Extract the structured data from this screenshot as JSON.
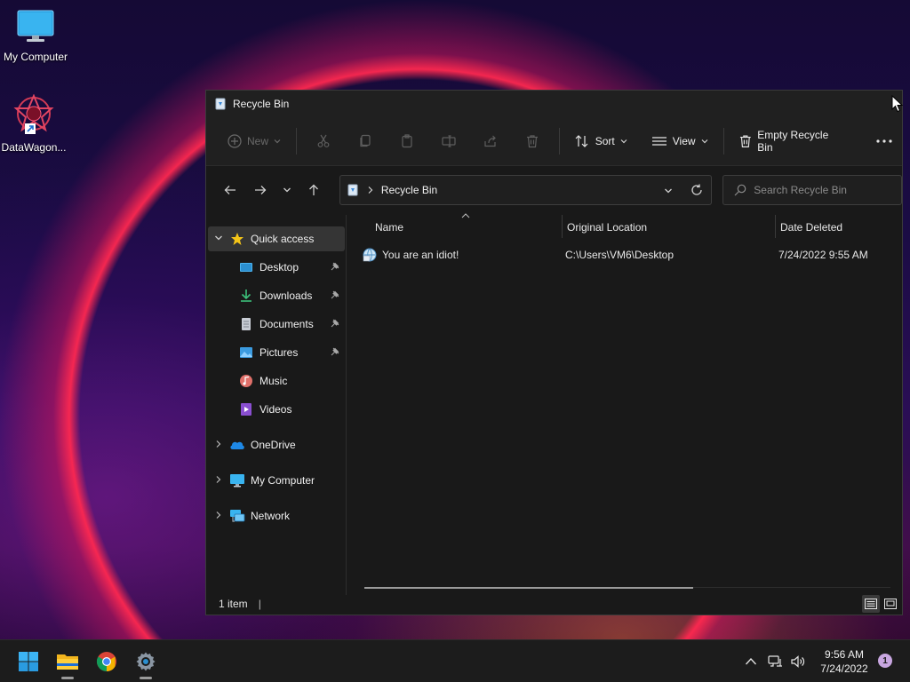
{
  "desktop": {
    "icons": [
      {
        "label": "My Computer",
        "icon": "monitor-icon"
      },
      {
        "label": "DataWagon...",
        "icon": "datawagon-shortcut-icon"
      }
    ]
  },
  "window": {
    "title": "Recycle Bin",
    "toolbar": {
      "new_label": "New",
      "sort_label": "Sort",
      "view_label": "View",
      "empty_label": "Empty Recycle Bin",
      "icons": [
        "cut-icon",
        "copy-icon",
        "paste-icon",
        "rename-icon",
        "share-icon",
        "delete-icon"
      ]
    },
    "address": {
      "crumb": "Recycle Bin",
      "search_placeholder": "Search Recycle Bin"
    },
    "sidebar": {
      "quick_access": "Quick access",
      "items": [
        {
          "label": "Desktop",
          "icon": "desktop-folder-icon",
          "pinned": true
        },
        {
          "label": "Downloads",
          "icon": "downloads-folder-icon",
          "pinned": true
        },
        {
          "label": "Documents",
          "icon": "documents-folder-icon",
          "pinned": true
        },
        {
          "label": "Pictures",
          "icon": "pictures-folder-icon",
          "pinned": true
        },
        {
          "label": "Music",
          "icon": "music-folder-icon",
          "pinned": false
        },
        {
          "label": "Videos",
          "icon": "videos-folder-icon",
          "pinned": false
        }
      ],
      "roots": [
        {
          "label": "OneDrive",
          "icon": "onedrive-icon"
        },
        {
          "label": "My Computer",
          "icon": "monitor-icon"
        },
        {
          "label": "Network",
          "icon": "network-icon"
        }
      ]
    },
    "columns": {
      "name": "Name",
      "original_location": "Original Location",
      "date_deleted": "Date Deleted"
    },
    "files": [
      {
        "name": "You are an idiot!",
        "original_location": "C:\\Users\\VM6\\Desktop",
        "date_deleted": "7/24/2022 9:55 AM"
      }
    ],
    "status": {
      "count": "1 item",
      "separator": "|"
    }
  },
  "taskbar": {
    "apps": [
      "start-icon",
      "file-explorer-icon",
      "chrome-icon",
      "settings-icon"
    ],
    "clock_time": "9:56 AM",
    "clock_date": "7/24/2022",
    "notification_count": "1"
  },
  "colors": {
    "accent": "#4cc2ff",
    "window_bg": "#191919",
    "toolbar_bg": "#202020",
    "selection": "#353535"
  }
}
